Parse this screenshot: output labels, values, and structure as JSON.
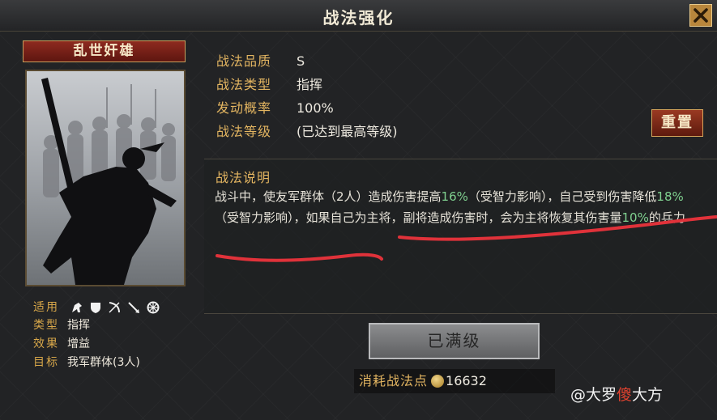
{
  "window": {
    "title": "战法强化"
  },
  "card": {
    "name": "乱世奸雄"
  },
  "info": {
    "apply_label": "适用",
    "type_label": "类型",
    "type_value": "指挥",
    "effect_label": "效果",
    "effect_value": "增益",
    "target_label": "目标",
    "target_value": "我军群体(3人)",
    "apply_icons": [
      "cavalry-icon",
      "shield-icon",
      "bow-icon",
      "spear-icon",
      "siege-wheel-icon"
    ]
  },
  "stats": [
    {
      "label": "战法品质",
      "value": "S"
    },
    {
      "label": "战法类型",
      "value": "指挥"
    },
    {
      "label": "发动概率",
      "value": "100%"
    },
    {
      "label": "战法等级",
      "value": "(已达到最高等级)"
    }
  ],
  "buttons": {
    "reset": "重置",
    "max": "已满级"
  },
  "description": {
    "title": "战法说明",
    "p1": "战斗中，使友军群体（2人）造成伤害提高",
    "v1": "16%",
    "p2": "（受智力影响），自己受到伤害降低",
    "v2": "18%",
    "p3": "（受智力影响），如果自己为主将，副将造成伤害时，会为主将恢复其伤害量",
    "v3": "10%",
    "p4": "的兵力"
  },
  "cost": {
    "label": "消耗战法点",
    "value": "16632"
  },
  "watermark": {
    "prefix": "@大罗",
    "red": "傻",
    "suffix": "大方"
  },
  "colors": {
    "accent": "#e3b561",
    "highlight": "#7fd08f",
    "annotation": "#e0323a"
  }
}
